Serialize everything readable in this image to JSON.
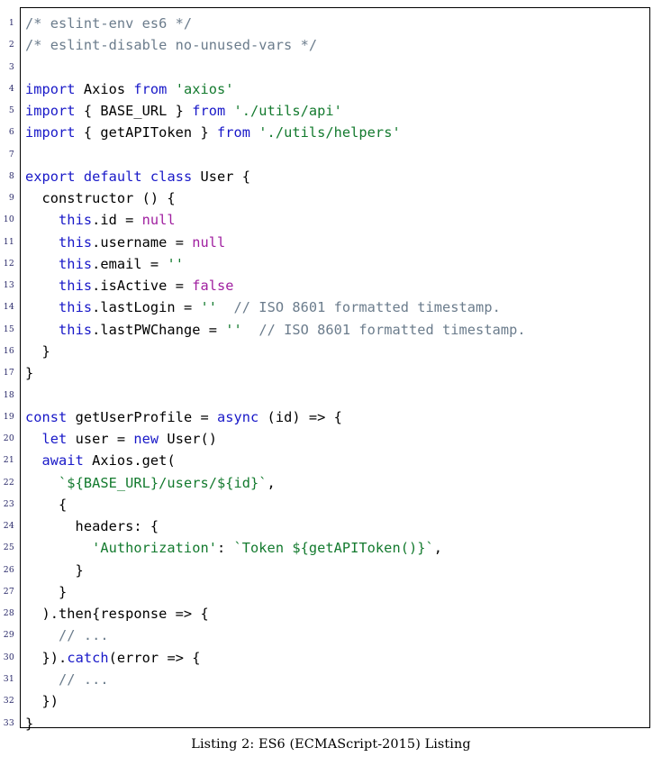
{
  "listing": {
    "caption": "Listing 2: ES6 (ECMAScript-2015) Listing",
    "language": "ES6 (ECMAScript-2015)",
    "first_line_number": 1,
    "last_line_number": 33,
    "colors": {
      "keyword": "#1818c8",
      "string": "#137a2e",
      "literal": "#a020a0",
      "comment": "#6b7c8c",
      "plain": "#000000",
      "linenumber": "#2a2a6a",
      "frame": "#000000",
      "background": "#ffffff"
    },
    "lines": [
      {
        "n": "1",
        "tokens": [
          {
            "t": "/* eslint-env es6 */",
            "c": "cmt"
          }
        ]
      },
      {
        "n": "2",
        "tokens": [
          {
            "t": "/* eslint-disable no-unused-vars */",
            "c": "cmt"
          }
        ]
      },
      {
        "n": "3",
        "tokens": [
          {
            "t": "",
            "c": "plain"
          }
        ]
      },
      {
        "n": "4",
        "tokens": [
          {
            "t": "import",
            "c": "kw"
          },
          {
            "t": " Axios ",
            "c": "plain"
          },
          {
            "t": "from",
            "c": "kw"
          },
          {
            "t": " ",
            "c": "plain"
          },
          {
            "t": "'axios'",
            "c": "str"
          }
        ]
      },
      {
        "n": "5",
        "tokens": [
          {
            "t": "import",
            "c": "kw"
          },
          {
            "t": " { BASE_URL } ",
            "c": "plain"
          },
          {
            "t": "from",
            "c": "kw"
          },
          {
            "t": " ",
            "c": "plain"
          },
          {
            "t": "'./utils/api'",
            "c": "str"
          }
        ]
      },
      {
        "n": "6",
        "tokens": [
          {
            "t": "import",
            "c": "kw"
          },
          {
            "t": " { getAPIToken } ",
            "c": "plain"
          },
          {
            "t": "from",
            "c": "kw"
          },
          {
            "t": " ",
            "c": "plain"
          },
          {
            "t": "'./utils/helpers'",
            "c": "str"
          }
        ]
      },
      {
        "n": "7",
        "tokens": [
          {
            "t": "",
            "c": "plain"
          }
        ]
      },
      {
        "n": "8",
        "tokens": [
          {
            "t": "export",
            "c": "kw"
          },
          {
            "t": " ",
            "c": "plain"
          },
          {
            "t": "default",
            "c": "kw"
          },
          {
            "t": " ",
            "c": "plain"
          },
          {
            "t": "class",
            "c": "kw"
          },
          {
            "t": " User {",
            "c": "plain"
          }
        ]
      },
      {
        "n": "9",
        "tokens": [
          {
            "t": "  constructor () {",
            "c": "plain"
          }
        ]
      },
      {
        "n": "10",
        "tokens": [
          {
            "t": "    ",
            "c": "plain"
          },
          {
            "t": "this",
            "c": "kw"
          },
          {
            "t": ".id = ",
            "c": "plain"
          },
          {
            "t": "null",
            "c": "lit"
          }
        ]
      },
      {
        "n": "11",
        "tokens": [
          {
            "t": "    ",
            "c": "plain"
          },
          {
            "t": "this",
            "c": "kw"
          },
          {
            "t": ".username = ",
            "c": "plain"
          },
          {
            "t": "null",
            "c": "lit"
          }
        ]
      },
      {
        "n": "12",
        "tokens": [
          {
            "t": "    ",
            "c": "plain"
          },
          {
            "t": "this",
            "c": "kw"
          },
          {
            "t": ".email = ",
            "c": "plain"
          },
          {
            "t": "''",
            "c": "str"
          }
        ]
      },
      {
        "n": "13",
        "tokens": [
          {
            "t": "    ",
            "c": "plain"
          },
          {
            "t": "this",
            "c": "kw"
          },
          {
            "t": ".isActive = ",
            "c": "plain"
          },
          {
            "t": "false",
            "c": "lit"
          }
        ]
      },
      {
        "n": "14",
        "tokens": [
          {
            "t": "    ",
            "c": "plain"
          },
          {
            "t": "this",
            "c": "kw"
          },
          {
            "t": ".lastLogin = ",
            "c": "plain"
          },
          {
            "t": "''",
            "c": "str"
          },
          {
            "t": "  ",
            "c": "plain"
          },
          {
            "t": "// ISO 8601 formatted timestamp.",
            "c": "cmt"
          }
        ]
      },
      {
        "n": "15",
        "tokens": [
          {
            "t": "    ",
            "c": "plain"
          },
          {
            "t": "this",
            "c": "kw"
          },
          {
            "t": ".lastPWChange = ",
            "c": "plain"
          },
          {
            "t": "''",
            "c": "str"
          },
          {
            "t": "  ",
            "c": "plain"
          },
          {
            "t": "// ISO 8601 formatted timestamp.",
            "c": "cmt"
          }
        ]
      },
      {
        "n": "16",
        "tokens": [
          {
            "t": "  }",
            "c": "plain"
          }
        ]
      },
      {
        "n": "17",
        "tokens": [
          {
            "t": "}",
            "c": "plain"
          }
        ]
      },
      {
        "n": "18",
        "tokens": [
          {
            "t": "",
            "c": "plain"
          }
        ]
      },
      {
        "n": "19",
        "tokens": [
          {
            "t": "const",
            "c": "kw"
          },
          {
            "t": " getUserProfile = ",
            "c": "plain"
          },
          {
            "t": "async",
            "c": "kw"
          },
          {
            "t": " (id) => {",
            "c": "plain"
          }
        ]
      },
      {
        "n": "20",
        "tokens": [
          {
            "t": "  ",
            "c": "plain"
          },
          {
            "t": "let",
            "c": "kw"
          },
          {
            "t": " user = ",
            "c": "plain"
          },
          {
            "t": "new",
            "c": "kw"
          },
          {
            "t": " User()",
            "c": "plain"
          }
        ]
      },
      {
        "n": "21",
        "tokens": [
          {
            "t": "  ",
            "c": "plain"
          },
          {
            "t": "await",
            "c": "kw"
          },
          {
            "t": " Axios.get(",
            "c": "plain"
          }
        ]
      },
      {
        "n": "22",
        "tokens": [
          {
            "t": "    ",
            "c": "plain"
          },
          {
            "t": "`${BASE_URL}/users/${id}`",
            "c": "str"
          },
          {
            "t": ",",
            "c": "plain"
          }
        ]
      },
      {
        "n": "23",
        "tokens": [
          {
            "t": "    {",
            "c": "plain"
          }
        ]
      },
      {
        "n": "24",
        "tokens": [
          {
            "t": "      headers: {",
            "c": "plain"
          }
        ]
      },
      {
        "n": "25",
        "tokens": [
          {
            "t": "        ",
            "c": "plain"
          },
          {
            "t": "'Authorization'",
            "c": "str"
          },
          {
            "t": ": ",
            "c": "plain"
          },
          {
            "t": "`Token ${getAPIToken()}`",
            "c": "str"
          },
          {
            "t": ",",
            "c": "plain"
          }
        ]
      },
      {
        "n": "26",
        "tokens": [
          {
            "t": "      }",
            "c": "plain"
          }
        ]
      },
      {
        "n": "27",
        "tokens": [
          {
            "t": "    }",
            "c": "plain"
          }
        ]
      },
      {
        "n": "28",
        "tokens": [
          {
            "t": "  ).then{response => {",
            "c": "plain"
          }
        ]
      },
      {
        "n": "29",
        "tokens": [
          {
            "t": "    ",
            "c": "plain"
          },
          {
            "t": "// ...",
            "c": "cmt"
          }
        ]
      },
      {
        "n": "30",
        "tokens": [
          {
            "t": "  }).",
            "c": "plain"
          },
          {
            "t": "catch",
            "c": "kw"
          },
          {
            "t": "(error => {",
            "c": "plain"
          }
        ]
      },
      {
        "n": "31",
        "tokens": [
          {
            "t": "    ",
            "c": "plain"
          },
          {
            "t": "// ...",
            "c": "cmt"
          }
        ]
      },
      {
        "n": "32",
        "tokens": [
          {
            "t": "  })",
            "c": "plain"
          }
        ]
      },
      {
        "n": "33",
        "tokens": [
          {
            "t": "}",
            "c": "plain"
          }
        ]
      }
    ]
  }
}
